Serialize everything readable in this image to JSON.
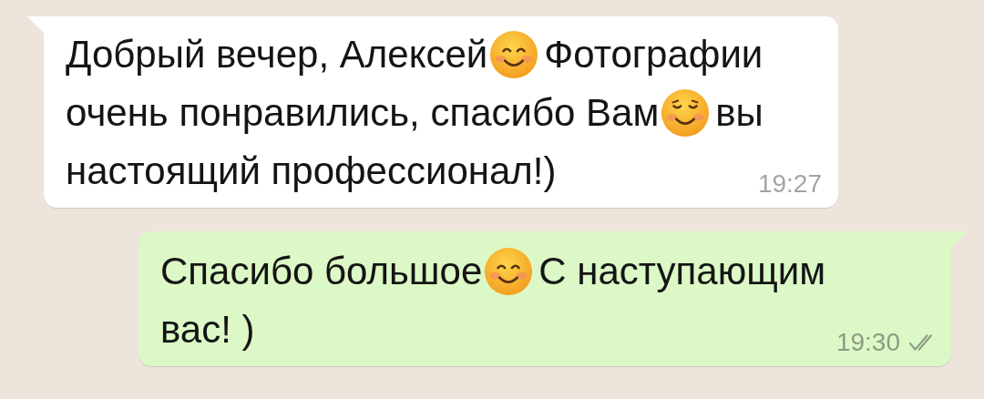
{
  "messages": [
    {
      "outgoing": false,
      "time": "19:27",
      "lines": [
        [
          {
            "kind": "text",
            "text": "Добрый вечер, Алексей"
          },
          {
            "kind": "smile"
          },
          {
            "kind": "text",
            "text": "Фотографии"
          }
        ],
        [
          {
            "kind": "text",
            "text": "очень понравились, спасибо Вам"
          },
          {
            "kind": "blush"
          },
          {
            "kind": "text",
            "text": "вы"
          }
        ],
        [
          {
            "kind": "text",
            "text": "настоящий профессионал!)"
          }
        ]
      ]
    },
    {
      "outgoing": true,
      "time": "19:30",
      "delivered": true,
      "lines": [
        [
          {
            "kind": "text",
            "text": "Спасибо большое"
          },
          {
            "kind": "smile"
          },
          {
            "kind": "text",
            "text": "С наступающим"
          }
        ],
        [
          {
            "kind": "text",
            "text": "вас! )"
          }
        ]
      ]
    }
  ]
}
